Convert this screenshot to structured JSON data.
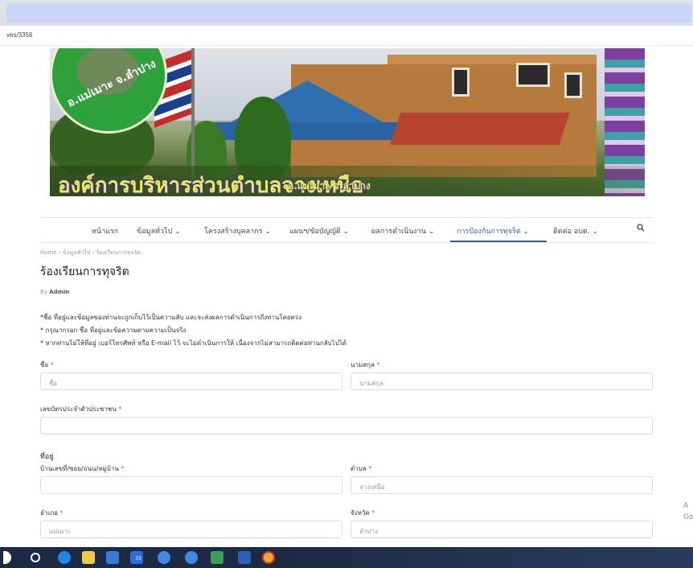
{
  "browser": {
    "url_fragment": "ves/3356"
  },
  "banner": {
    "seal_text": "อ.แม่เมาะ จ.ลำปาง",
    "title": "องค์การบริหารส่วนตำบลจางเหนือ",
    "subtitle": "อ.แม่เมาะ จ.ลำปาง"
  },
  "nav": {
    "items": [
      {
        "label": "หน้าแรก"
      },
      {
        "label": "ข้อมูลทั่วไป ⌄"
      },
      {
        "label": "โครงสร้างบุคลากร ⌄"
      },
      {
        "label": "แผนฯ/ข้อบัญญัติ ⌄"
      },
      {
        "label": "ผลการดำเนินงาน ⌄"
      },
      {
        "label": "การป้องกันการทุจริต ⌄"
      },
      {
        "label": "ติดต่อ อบต. ⌄"
      }
    ],
    "active_index": 5,
    "search_icon": "search-icon",
    "active_color": "#2f5fb8"
  },
  "breadcrumb": "Home  ›  ข้อมูลทั่วไป  ›  ร้องเรียนการทุจริต",
  "page": {
    "title": "ร้องเรียนการทุจริต",
    "by_label": "By",
    "author": "Admin"
  },
  "notes": [
    "*ชื่อ ที่อยู่และข้อมูลของท่านจะถูกเก็บไว้เป็นความลับ และจะส่งผลการดำเนินการถึงท่านโดยตรง",
    "* กรุณากรอก ชื่อ ที่อยู่และข้อความตามความเป็นจริง",
    "* หากท่านไม่ให้ที่อยู่ เบอร์โทรศัพท์ หรือ E-mail ไว้ จะไม่ดำเนินการให้ เนื่องจากไม่สามารถติดต่อท่านกลับไปได้"
  ],
  "form": {
    "first_name": {
      "label": "ชื่อ",
      "required": "*",
      "placeholder": "ชื่อ"
    },
    "last_name": {
      "label": "นามสกุล",
      "required": "*",
      "placeholder": "นามสกุล"
    },
    "id_card": {
      "label": "เลขบัตรประจำตัวประชาชน",
      "required": "*",
      "placeholder": ""
    },
    "address_heading": "ที่อยู่",
    "house": {
      "label": "บ้านเลขที่/ซอย/ถนน/หมู่บ้าน",
      "required": "*",
      "placeholder": ""
    },
    "subdistrict": {
      "label": "ตำบล",
      "required": "*",
      "placeholder": "จางเหนือ"
    },
    "district": {
      "label": "อำเภอ",
      "required": "*",
      "placeholder": "แม่เมาะ"
    },
    "province": {
      "label": "จังหวัด",
      "required": "*",
      "placeholder": "ลำปาง"
    }
  },
  "taskbar": {
    "badge": "33"
  },
  "watermark": {
    "line1": "A",
    "line2": "Go"
  }
}
